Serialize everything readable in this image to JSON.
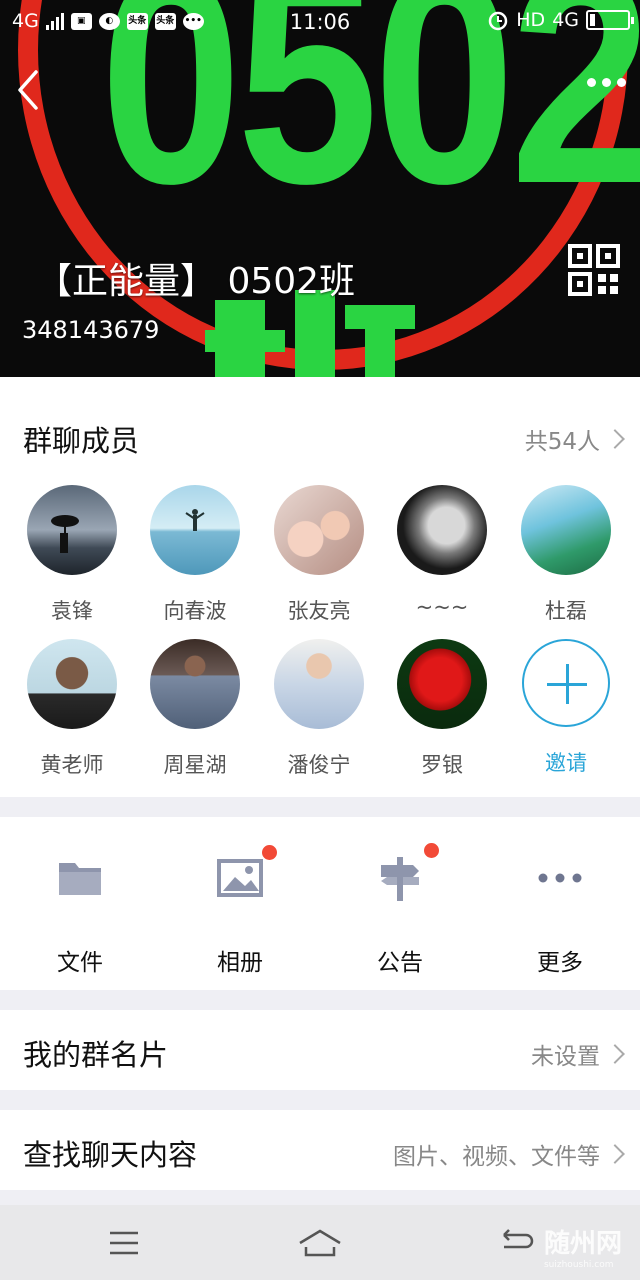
{
  "status_bar": {
    "network_left": "4G",
    "mini_badge_1": "头条",
    "mini_badge_2": "头条",
    "time": "11:06",
    "hd_label": "HD",
    "network_right": "4G"
  },
  "header": {
    "group_name": "【正能量】 0502班",
    "group_id": "348143679",
    "hero_digits": "0502",
    "colors": {
      "hero_green": "#2ad442",
      "hero_red": "#e0281c"
    }
  },
  "members_section": {
    "title": "群聊成员",
    "count_label": "共54人",
    "members": [
      {
        "name": "袁锋",
        "avatar": "man-with-umbrella-photo"
      },
      {
        "name": "向春波",
        "avatar": "person-on-water-photo"
      },
      {
        "name": "张友亮",
        "avatar": "mother-and-baby-photo"
      },
      {
        "name": "~~~",
        "avatar": "black-white-portrait-photo"
      },
      {
        "name": "杜磊",
        "avatar": "palm-tree-photo"
      },
      {
        "name": "黄老师",
        "avatar": "bald-man-photo"
      },
      {
        "name": "周星湖",
        "avatar": "man-in-plaid-shirt-photo"
      },
      {
        "name": "潘俊宁",
        "avatar": "man-in-light-shirt-photo"
      },
      {
        "name": "罗银",
        "avatar": "red-tulip-photo"
      }
    ],
    "invite_label": "邀请"
  },
  "tools": [
    {
      "label": "文件",
      "icon": "folder-icon",
      "has_badge": false
    },
    {
      "label": "相册",
      "icon": "photo-album-icon",
      "has_badge": true
    },
    {
      "label": "公告",
      "icon": "signpost-icon",
      "has_badge": true
    },
    {
      "label": "更多",
      "icon": "more-dots-icon",
      "has_badge": false
    }
  ],
  "rows": {
    "my_card": {
      "title": "我的群名片",
      "value": "未设置"
    },
    "search_chat": {
      "title": "查找聊天内容",
      "value": "图片、视频、文件等"
    }
  },
  "watermark": {
    "text": "随州网",
    "sub": "suizhoushi.com"
  },
  "colors": {
    "accent": "#2aa5d8",
    "badge": "#f24a37",
    "icon_gray": "#8e95ac"
  }
}
